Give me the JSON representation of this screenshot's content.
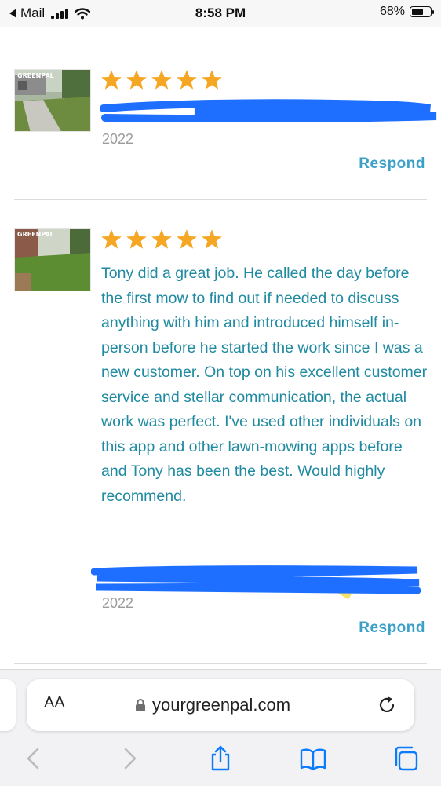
{
  "status_bar": {
    "back_app": "Mail",
    "time": "8:58 PM",
    "battery": "68%",
    "battery_level": 0.68
  },
  "reviews": [
    {
      "rating": 5,
      "thumb_label": "GREENPAL",
      "text": "",
      "year": "2022",
      "respond_label": "Respond"
    },
    {
      "rating": 5,
      "thumb_label": "GREENPAL",
      "text": "Tony did a great job. He called the day before the first mow to find out if needed to discuss anything with him and introduced himself in-person before he started the work since I was a new customer. On top on his excellent customer service and stellar communication, the actual work was perfect. I've used other individuals on this app and other lawn-mowing apps before and Tony has been the best. Would highly recommend.",
      "year": "2022",
      "respond_label": "Respond"
    }
  ],
  "browser": {
    "text_size_label": "AA",
    "url": "yourgreenpal.com"
  },
  "colors": {
    "star": "#f5a623",
    "review_text": "#1f8aa1",
    "respond": "#3aa0c8",
    "year": "#9c9c9c",
    "scribble": "#1e6fff",
    "toolbar_icon": "#0a7aff"
  },
  "icons": [
    "back-chevron-icon",
    "wifi-icon",
    "lock-icon",
    "reload-icon",
    "back-icon",
    "forward-icon",
    "share-icon",
    "bookmarks-icon",
    "tabs-icon"
  ]
}
